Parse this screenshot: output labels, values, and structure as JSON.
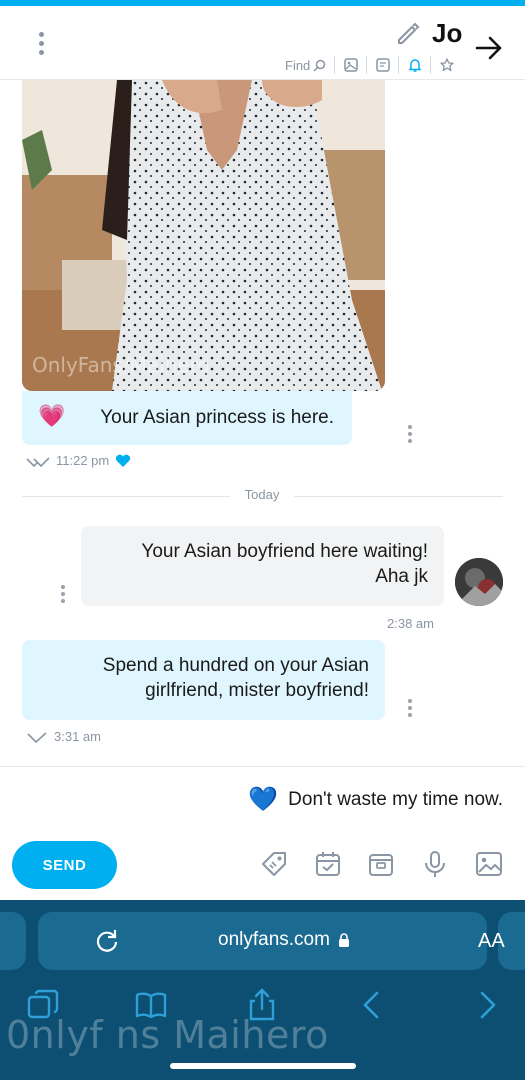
{
  "header": {
    "name": "Jo",
    "find_label": "Find",
    "icons": [
      "star-icon",
      "bell-icon",
      "note-icon",
      "image-icon"
    ]
  },
  "chat": {
    "messages": [
      {
        "text_line1": "Your Asian princess is here.",
        "emoji": "💗",
        "time": "11:22 pm",
        "direction": "incoming"
      },
      {
        "divider": "Today"
      },
      {
        "text_line1": "Your Asian boyfriend here waiting!",
        "text_line2": "Aha jk",
        "time": "2:38 am",
        "direction": "outgoing"
      },
      {
        "text_line1": "Spend a hundred on your Asian",
        "text_line2": "girlfriend, mister boyfriend!",
        "time": "3:31 am",
        "direction": "incoming"
      }
    ],
    "photo_watermark": "OnlyFans/Maihero"
  },
  "composer": {
    "draft": "Don't waste my time now.",
    "draft_emoji": "💙",
    "send_label": "SEND"
  },
  "browser": {
    "url": "onlyfans.com",
    "text_size_label": "AA",
    "watermark": "0nlyf ns Maihero"
  },
  "colors": {
    "accent": "#00aff0",
    "incoming_bubble": "#e0f6ff",
    "outgoing_bubble": "#f2f3f4",
    "browser_bar": "#0d4f72"
  }
}
